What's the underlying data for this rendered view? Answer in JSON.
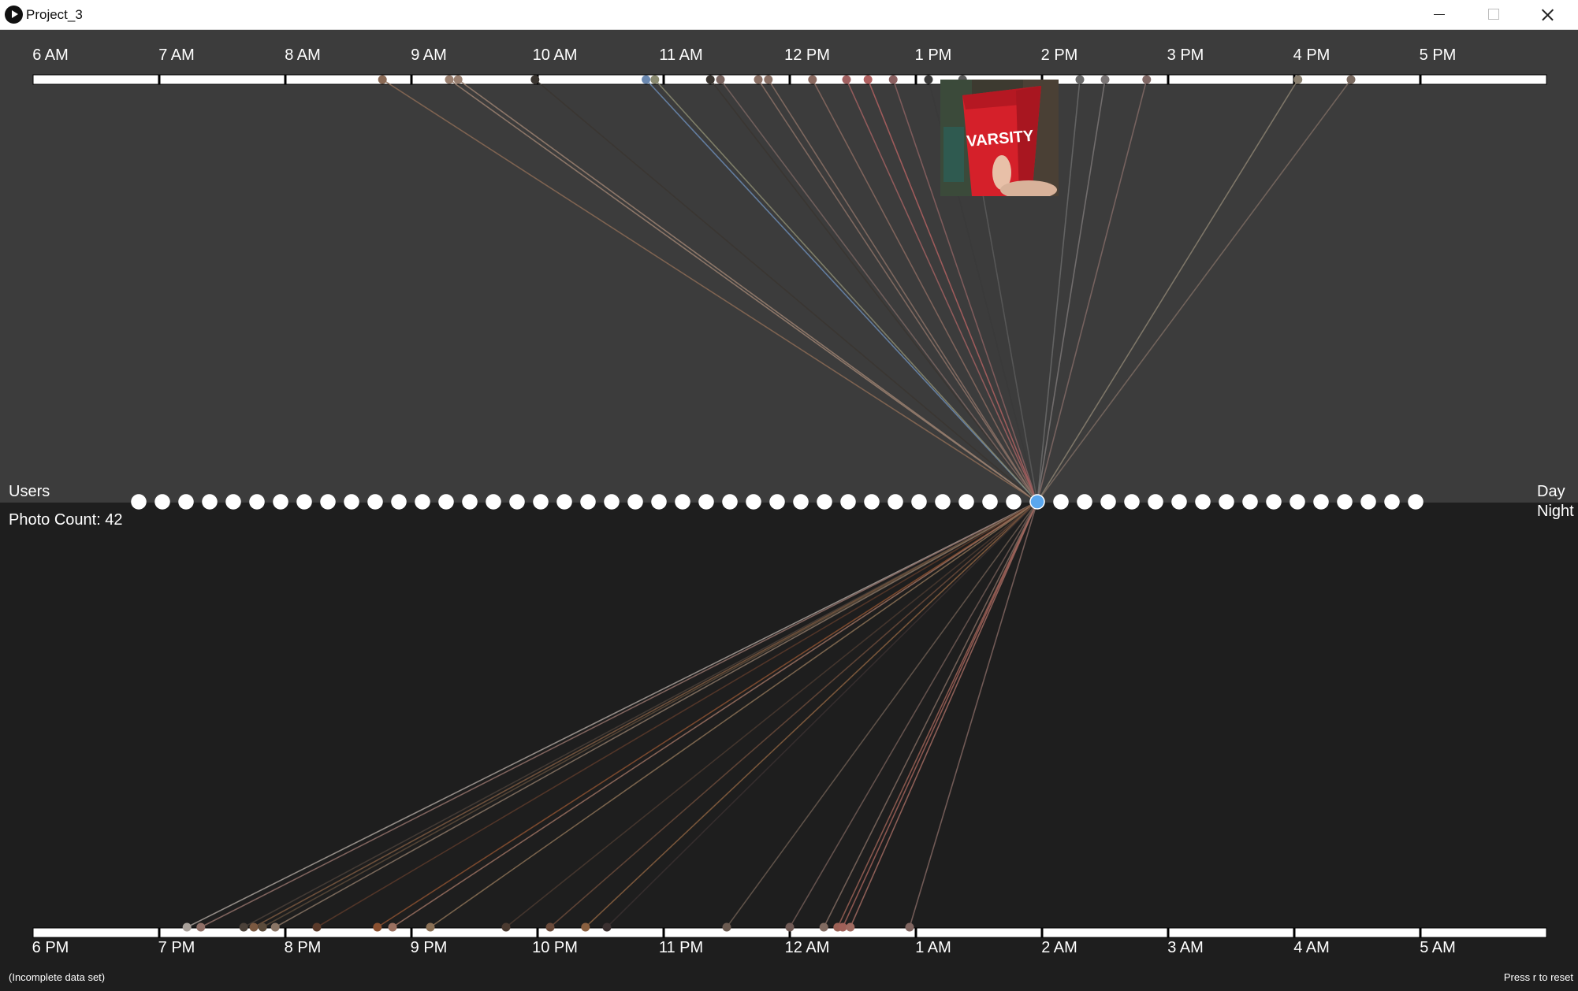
{
  "window": {
    "title": "Project_3"
  },
  "day_axis": {
    "ticks": [
      "6 AM",
      "7 AM",
      "8 AM",
      "9 AM",
      "10 AM",
      "11 AM",
      "12 PM",
      "1 PM",
      "2 PM",
      "3 PM",
      "4 PM",
      "5 PM"
    ]
  },
  "night_axis": {
    "ticks": [
      "6 PM",
      "7 PM",
      "8 PM",
      "9 PM",
      "10 PM",
      "11 PM",
      "12 AM",
      "1 AM",
      "2 AM",
      "3 AM",
      "4 AM",
      "5 AM"
    ]
  },
  "labels": {
    "users": "Users",
    "photo_count": "Photo Count: 42",
    "day": "Day",
    "night": "Night",
    "incomplete": "(Incomplete data set)",
    "reset_hint": "Press r to reset"
  },
  "thumbnail": {
    "caption": "VARSITY"
  },
  "users": {
    "count": 55,
    "selected_index": 38
  },
  "colors": {
    "day_bg": "#3c3c3c",
    "night_bg": "#1e1e1e",
    "selected_user": "#5aa7ee",
    "user_dot": "#ffffff"
  },
  "day_photos": [
    {
      "hour": 8.77,
      "color": "#8a6a55"
    },
    {
      "hour": 9.3,
      "color": "#9a8070"
    },
    {
      "hour": 9.37,
      "color": "#9a8070"
    },
    {
      "hour": 9.98,
      "color": "#3a3530"
    },
    {
      "hour": 10.86,
      "color": "#6a88b0"
    },
    {
      "hour": 10.93,
      "color": "#8a8a70"
    },
    {
      "hour": 11.37,
      "color": "#3a3530"
    },
    {
      "hour": 11.45,
      "color": "#7a6560"
    },
    {
      "hour": 11.75,
      "color": "#8a7065"
    },
    {
      "hour": 11.83,
      "color": "#8a7065"
    },
    {
      "hour": 12.18,
      "color": "#8a6a60"
    },
    {
      "hour": 12.45,
      "color": "#a06060"
    },
    {
      "hour": 12.62,
      "color": "#b06060"
    },
    {
      "hour": 12.82,
      "color": "#8a6060"
    },
    {
      "hour": 13.1,
      "color": "#3a3a3a"
    },
    {
      "hour": 13.37,
      "color": "#5a5a5a"
    },
    {
      "hour": 14.3,
      "color": "#6a6a6a"
    },
    {
      "hour": 14.5,
      "color": "#7a7575"
    },
    {
      "hour": 14.83,
      "color": "#806865"
    },
    {
      "hour": 16.03,
      "color": "#8a8070"
    },
    {
      "hour": 16.45,
      "color": "#7a6a60"
    }
  ],
  "night_photos": [
    {
      "hour": 19.22,
      "color": "#a8a09a"
    },
    {
      "hour": 19.33,
      "color": "#907068"
    },
    {
      "hour": 19.67,
      "color": "#4a4038"
    },
    {
      "hour": 19.75,
      "color": "#7a5840"
    },
    {
      "hour": 19.82,
      "color": "#5a4a3a"
    },
    {
      "hour": 19.92,
      "color": "#8a7565"
    },
    {
      "hour": 20.25,
      "color": "#5a3a2a"
    },
    {
      "hour": 20.73,
      "color": "#8a5030"
    },
    {
      "hour": 20.85,
      "color": "#9a7060"
    },
    {
      "hour": 21.15,
      "color": "#8a7055"
    },
    {
      "hour": 21.75,
      "color": "#4a3a30"
    },
    {
      "hour": 22.1,
      "color": "#6a4a3a"
    },
    {
      "hour": 22.38,
      "color": "#8a6040"
    },
    {
      "hour": 22.55,
      "color": "#3a3030"
    },
    {
      "hour": 24.27,
      "color": "#806a60"
    },
    {
      "hour": 24.38,
      "color": "#9a6055"
    },
    {
      "hour": 24.42,
      "color": "#a06058"
    },
    {
      "hour": 24.48,
      "color": "#a06a60"
    },
    {
      "hour": 24.95,
      "color": "#806560"
    },
    {
      "hour": 24.0,
      "color": "#705a55"
    },
    {
      "hour": 23.5,
      "color": "#6a5a50"
    }
  ]
}
